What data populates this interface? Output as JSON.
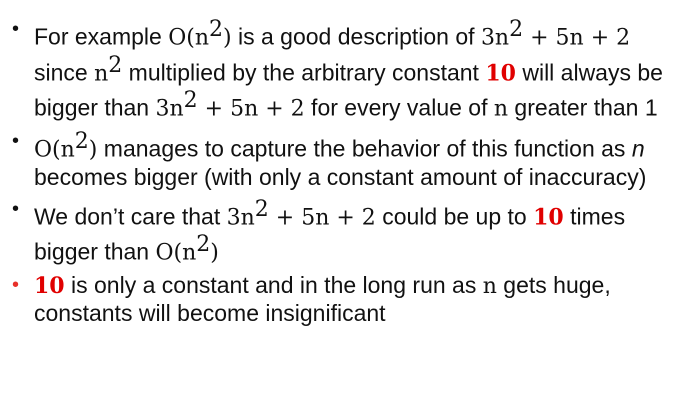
{
  "slide": {
    "bullets": [
      {
        "marker": "•",
        "marker_color": "#111111",
        "segments": [
          {
            "text": "For example ",
            "style": "text"
          },
          {
            "text": "O(n",
            "style": "math"
          },
          {
            "text": "2",
            "style": "sup"
          },
          {
            "text": ")",
            "style": "math"
          },
          {
            "text": " is a good description of ",
            "style": "text"
          },
          {
            "text": "3n",
            "style": "math"
          },
          {
            "text": "2",
            "style": "sup"
          },
          {
            "text": " + 5n + 2",
            "style": "math"
          },
          {
            "text": " since ",
            "style": "text"
          },
          {
            "text": "n",
            "style": "math"
          },
          {
            "text": "2",
            "style": "sup"
          },
          {
            "text": " multiplied by the arbitrary constant ",
            "style": "text"
          },
          {
            "text": "10",
            "style": "emph"
          },
          {
            "text": " will always be bigger than ",
            "style": "text"
          },
          {
            "text": "3n",
            "style": "math"
          },
          {
            "text": "2",
            "style": "sup"
          },
          {
            "text": " + 5n + 2",
            "style": "math"
          },
          {
            "text": " for every value of ",
            "style": "text"
          },
          {
            "text": "n",
            "style": "math"
          },
          {
            "text": " greater than 1",
            "style": "text"
          }
        ]
      },
      {
        "marker": "•",
        "marker_color": "#111111",
        "segments": [
          {
            "text": "O(n",
            "style": "math"
          },
          {
            "text": "2",
            "style": "sup"
          },
          {
            "text": ")",
            "style": "math"
          },
          {
            "text": " manages to capture the behavior of this function as ",
            "style": "text"
          },
          {
            "text": "n",
            "style": "ital"
          },
          {
            "text": " becomes bigger (with only a constant amount of inaccuracy)",
            "style": "text"
          }
        ]
      },
      {
        "marker": "•",
        "marker_color": "#111111",
        "segments": [
          {
            "text": "We don’t care that ",
            "style": "text"
          },
          {
            "text": "3n",
            "style": "math"
          },
          {
            "text": "2",
            "style": "sup"
          },
          {
            "text": " + 5n + 2",
            "style": "math"
          },
          {
            "text": " could be up to ",
            "style": "text"
          },
          {
            "text": "10",
            "style": "emph"
          },
          {
            "text": " times bigger than ",
            "style": "text"
          },
          {
            "text": "O(n",
            "style": "math"
          },
          {
            "text": "2",
            "style": "sup"
          },
          {
            "text": ")",
            "style": "math"
          }
        ]
      },
      {
        "marker": "•",
        "marker_color": "#e8312a",
        "segments": [
          {
            "text": "10",
            "style": "emph"
          },
          {
            "text": " is only a constant and in the long run as ",
            "style": "text"
          },
          {
            "text": "n",
            "style": "math"
          },
          {
            "text": " gets huge, constants will become insignificant",
            "style": "text"
          }
        ]
      }
    ]
  }
}
